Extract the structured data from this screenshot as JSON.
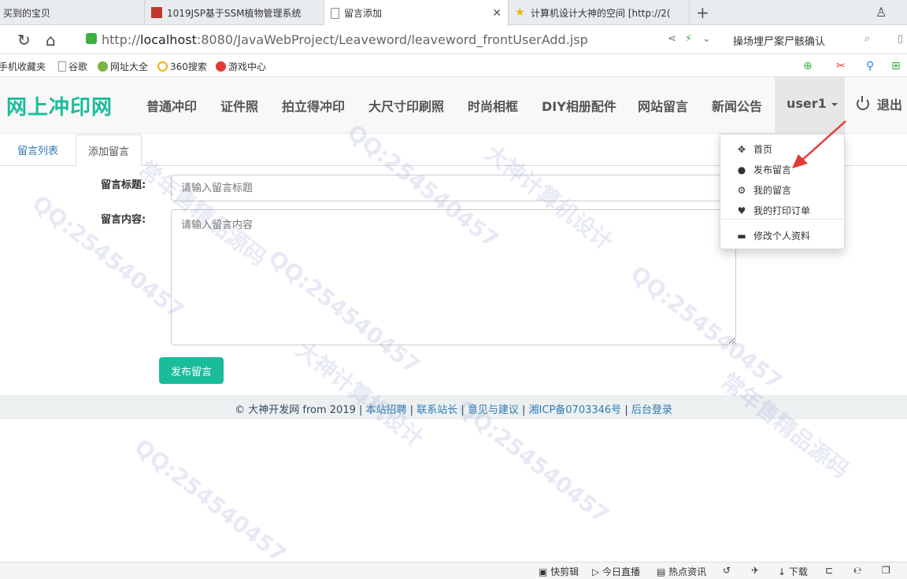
{
  "browser": {
    "tabs": [
      {
        "label": "买到的宝贝"
      },
      {
        "label": "1019JSP基于SSM植物管理系统"
      },
      {
        "label": "留言添加"
      },
      {
        "label": "计算机设计大神的空间 [http://2("
      }
    ],
    "url_prefix": "http://",
    "url_host": "localhost",
    "url_rest": ":8080/JavaWebProject/Leaveword/leaveword_frontUserAdd.jsp",
    "search_text": "操场埋尸案尸骸确认",
    "bookmarks": [
      "手机收藏夹",
      "谷歌",
      "网址大全",
      "360搜索",
      "游戏中心"
    ]
  },
  "site": {
    "brand": "网上冲印网",
    "nav": [
      "普通冲印",
      "证件照",
      "拍立得冲印",
      "大尺寸印刷照",
      "时尚相框",
      "DIY相册配件",
      "网站留言",
      "新闻公告"
    ],
    "user": "user1",
    "logout": "退出"
  },
  "subtabs": [
    "留言列表",
    "添加留言"
  ],
  "form": {
    "title_label": "留言标题:",
    "title_placeholder": "请输入留言标题",
    "content_label": "留言内容:",
    "content_placeholder": "请输入留言内容",
    "submit": "发布留言"
  },
  "dropdown": [
    "首页",
    "发布留言",
    "我的留言",
    "我的打印订单",
    "修改个人资料"
  ],
  "footer": {
    "copyright": "© 大神开发网 from 2019",
    "links": [
      "本站招聘",
      "联系站长",
      "意见与建议",
      "湘ICP备0703346号",
      "后台登录"
    ]
  },
  "statusbar": [
    "快剪辑",
    "今日直播",
    "热点资讯",
    "下载"
  ],
  "watermark": [
    "大神计算机设计",
    "QQ:254540457",
    "常年售精品源码"
  ],
  "colors": {
    "brand": "#1abc9c",
    "link": "#337ab7"
  }
}
